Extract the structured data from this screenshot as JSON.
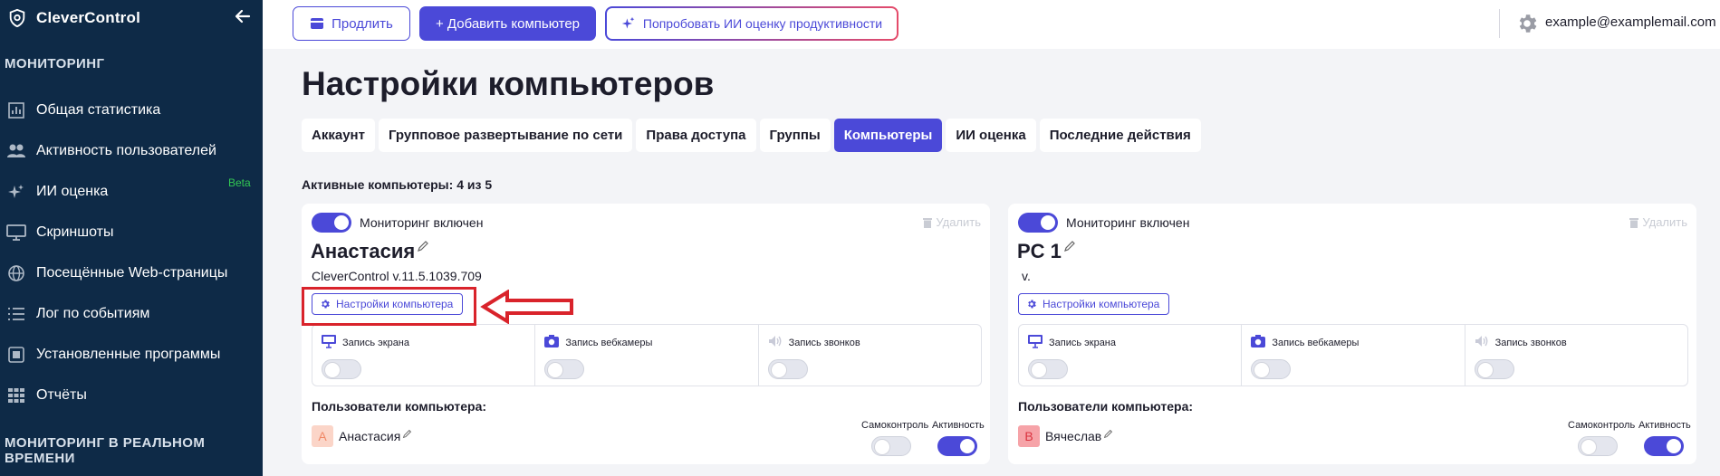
{
  "sidebar": {
    "brand": "CleverControl",
    "section_monitoring": "МОНИТОРИНГ",
    "section_realtime": "МОНИТОРИНГ В РЕАЛЬНОМ ВРЕМЕНИ",
    "items": [
      {
        "label": "Общая статистика",
        "icon": "bar-chart-icon"
      },
      {
        "label": "Активность пользователей",
        "icon": "users-icon"
      },
      {
        "label": "ИИ оценка",
        "icon": "sparkle-icon",
        "badge": "Beta"
      },
      {
        "label": "Скриншоты",
        "icon": "monitor-icon"
      },
      {
        "label": "Посещённые Web-страницы",
        "icon": "globe-icon"
      },
      {
        "label": "Лог по событиям",
        "icon": "list-icon"
      },
      {
        "label": "Установленные программы",
        "icon": "installed-apps-icon"
      },
      {
        "label": "Отчёты",
        "icon": "grid-icon"
      }
    ]
  },
  "topbar": {
    "extend_label": "Продлить",
    "add_computer_label": "+ Добавить компьютер",
    "try_ai_label": "Попробовать ИИ оценку продуктивности",
    "user_email": "example@examplemail.com"
  },
  "page": {
    "title": "Настройки компьютеров",
    "tabs": [
      {
        "label": "Аккаунт",
        "active": false
      },
      {
        "label": "Групповое развертывание по сети",
        "active": false
      },
      {
        "label": "Права доступа",
        "active": false
      },
      {
        "label": "Группы",
        "active": false
      },
      {
        "label": "Компьютеры",
        "active": true
      },
      {
        "label": "ИИ оценка",
        "active": false
      },
      {
        "label": "Последние действия",
        "active": false
      }
    ],
    "active_computers": "Активные компьютеры: 4 из 5"
  },
  "common": {
    "monitoring_on": "Мониторинг включен",
    "delete": "Удалить",
    "settings_button": "Настройки компьютера",
    "screen_rec": "Запись экрана",
    "webcam_rec": "Запись вебкамеры",
    "call_rec": "Запись звонков",
    "users_title": "Пользователи компьютера:",
    "self_control": "Самоконтроль",
    "activity": "Активность"
  },
  "computers": [
    {
      "name": "Анастасия",
      "version": "CleverControl v.11.5.1039.709",
      "monitoring": true,
      "screen": false,
      "webcam": false,
      "calls": false,
      "user": {
        "initial": "А",
        "name": "Анастасия",
        "self_control": false,
        "activity": true,
        "avatar_bg": "#fbd5c8",
        "avatar_fg": "#f08866"
      }
    },
    {
      "name": "PC 1",
      "version": "v.",
      "monitoring": true,
      "screen": false,
      "webcam": false,
      "calls": false,
      "user": {
        "initial": "В",
        "name": "Вячеслав",
        "self_control": false,
        "activity": true,
        "avatar_bg": "#f6a3a8",
        "avatar_fg": "#d9333f"
      }
    }
  ],
  "colors": {
    "sidebar_bg": "#0e2a47",
    "accent": "#4b49d8",
    "beta_green": "#32c853",
    "annotation_red": "#d9232b"
  }
}
